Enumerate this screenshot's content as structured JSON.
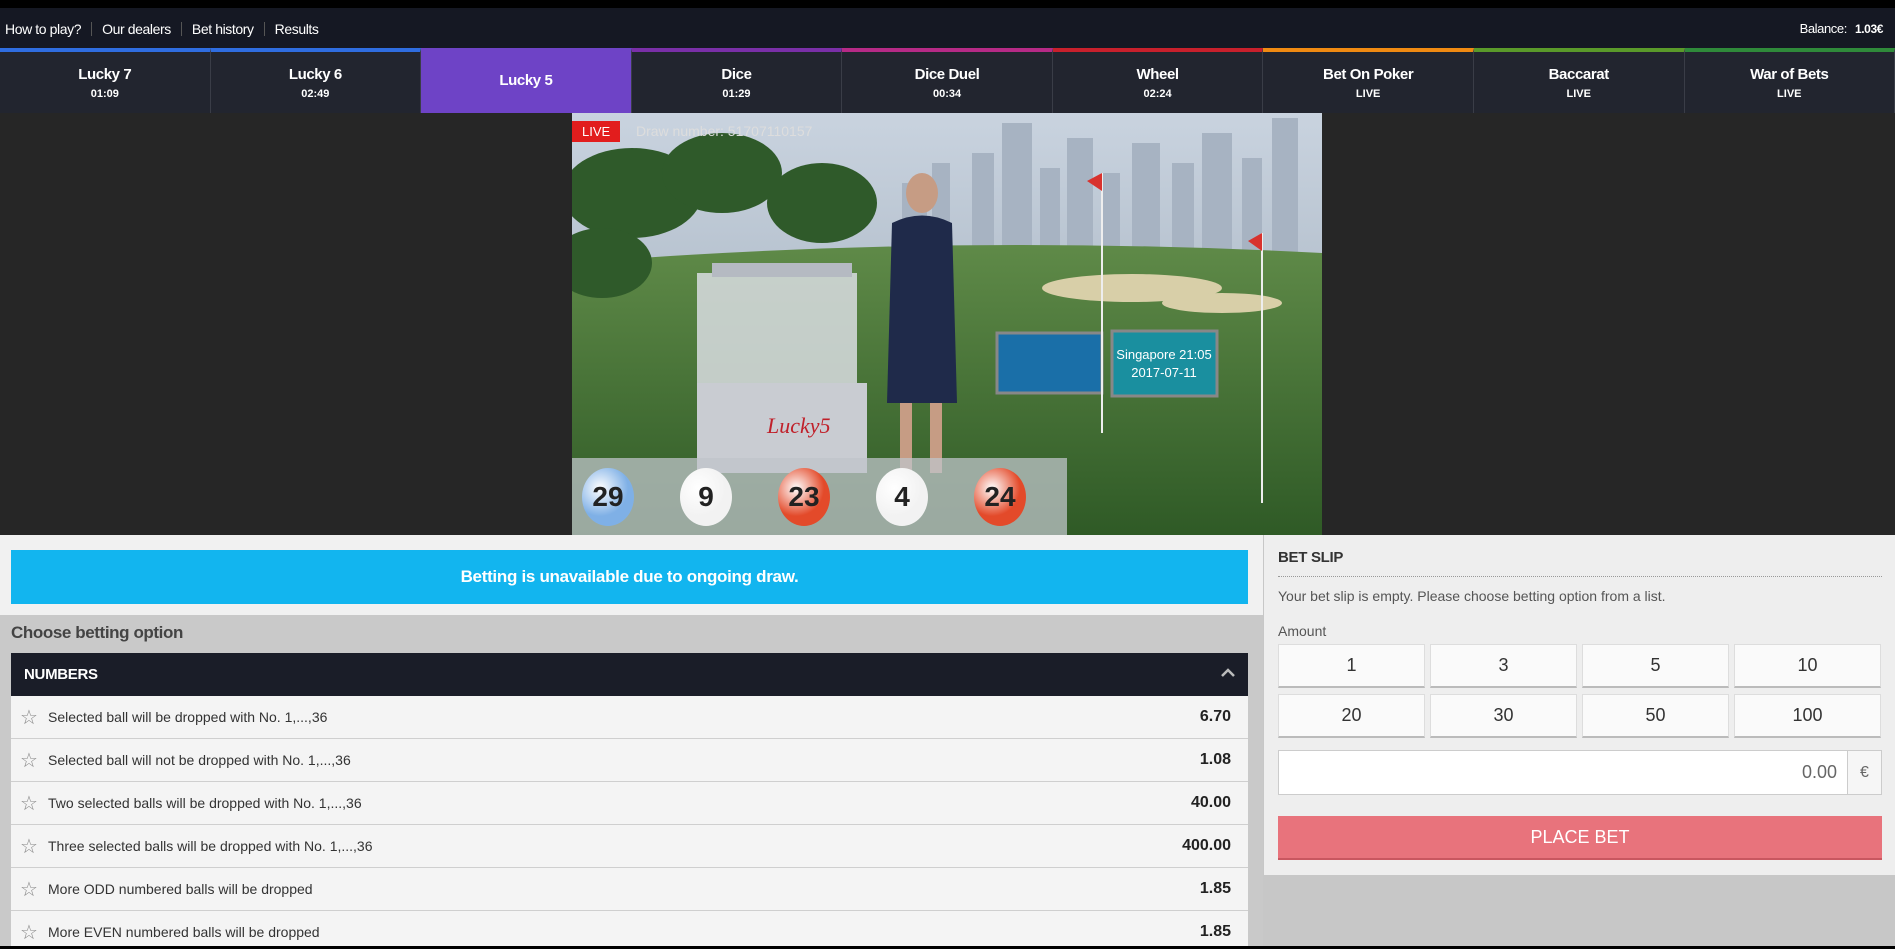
{
  "topbar": {
    "links": [
      "How to play?",
      "Our dealers",
      "Bet history",
      "Results"
    ],
    "balance_label": "Balance:",
    "balance_value": "1.03€"
  },
  "tabs": [
    {
      "name": "Lucky 7",
      "time": "01:09",
      "color": "#2f6de0"
    },
    {
      "name": "Lucky 6",
      "time": "02:49",
      "color": "#2f6de0"
    },
    {
      "name": "Lucky 5",
      "time": "",
      "color": "#6e43c6",
      "active": true
    },
    {
      "name": "Dice",
      "time": "01:29",
      "color": "#7a2fa8"
    },
    {
      "name": "Dice Duel",
      "time": "00:34",
      "color": "#b62a86"
    },
    {
      "name": "Wheel",
      "time": "02:24",
      "color": "#c8202c"
    },
    {
      "name": "Bet On Poker",
      "time": "LIVE",
      "color": "#f08a12"
    },
    {
      "name": "Baccarat",
      "time": "LIVE",
      "color": "#5a9a2a"
    },
    {
      "name": "War of Bets",
      "time": "LIVE",
      "color": "#2f8a3a"
    }
  ],
  "video": {
    "live_label": "LIVE",
    "draw_number": "Draw number: 51707110157",
    "screen_text_1": "Singapore 21:05",
    "screen_text_2": "2017-07-11",
    "brand": "Lucky5",
    "balls": [
      {
        "num": "29",
        "color": "#7fb0e6"
      },
      {
        "num": "9",
        "color": "#f2f2f2"
      },
      {
        "num": "23",
        "color": "#e34a2a"
      },
      {
        "num": "4",
        "color": "#f2f2f2"
      },
      {
        "num": "24",
        "color": "#e34a2a"
      }
    ]
  },
  "notice": "Betting is unavailable due to ongoing draw.",
  "choose_label": "Choose betting option",
  "numbers_section": {
    "title": "NUMBERS",
    "rows": [
      {
        "label": "Selected ball will be dropped with No. 1,...,36",
        "odd": "6.70"
      },
      {
        "label": "Selected ball will not be dropped with No. 1,...,36",
        "odd": "1.08"
      },
      {
        "label": "Two selected balls will be dropped with No. 1,...,36",
        "odd": "40.00"
      },
      {
        "label": "Three selected balls will be dropped with No. 1,...,36",
        "odd": "400.00"
      },
      {
        "label": "More ODD numbered balls will be dropped",
        "odd": "1.85"
      },
      {
        "label": "More EVEN numbered balls will be dropped",
        "odd": "1.85"
      }
    ]
  },
  "bet_slip": {
    "title": "BET SLIP",
    "empty_text": "Your bet slip is empty. Please choose betting option from a list.",
    "amount_label": "Amount",
    "chips": [
      "1",
      "3",
      "5",
      "10",
      "20",
      "30",
      "50",
      "100"
    ],
    "amount_value": "0.00",
    "currency": "€",
    "place_bet_label": "PLACE BET"
  }
}
